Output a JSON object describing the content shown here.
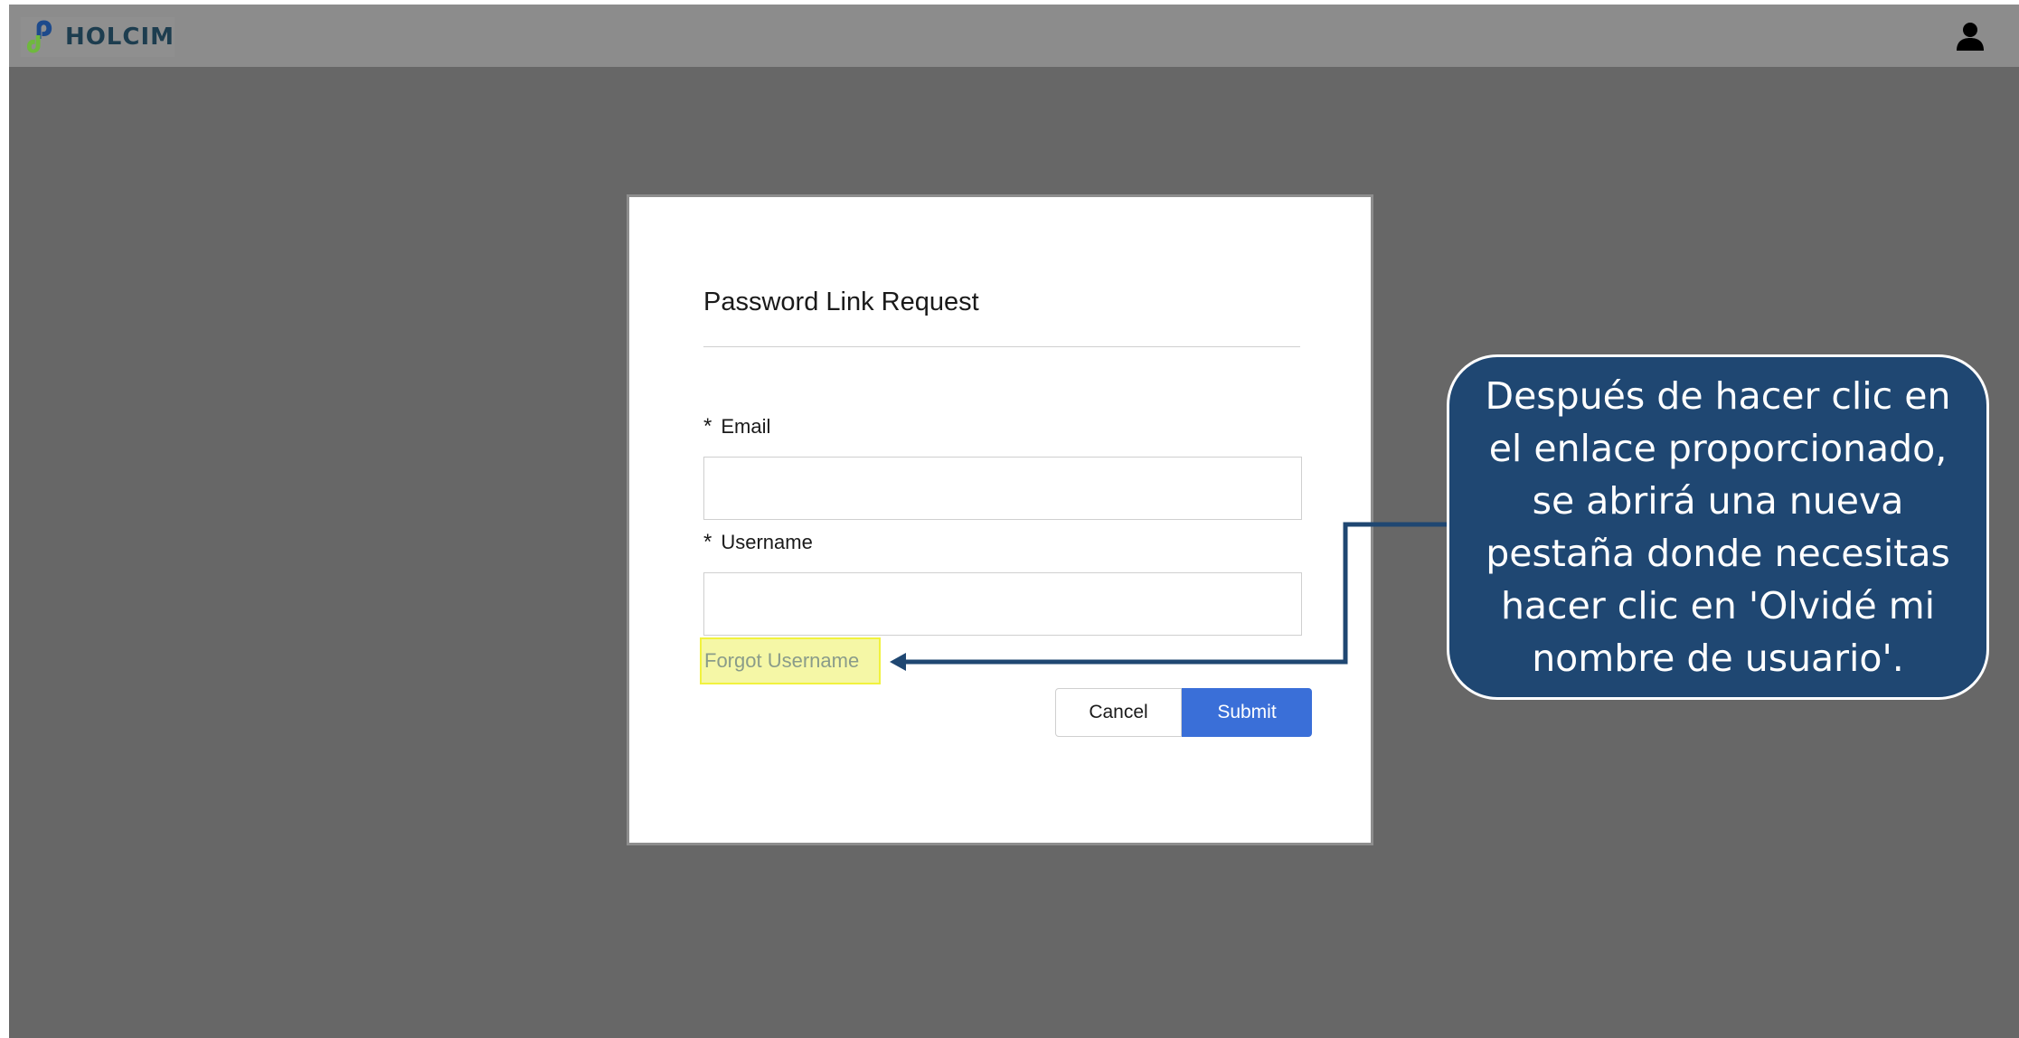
{
  "header": {
    "logo_text": "HOLCIM",
    "logo_icon": "holcim-logo-mark",
    "user_icon": "user-icon"
  },
  "modal": {
    "title": "Password Link Request",
    "email_label": "Email",
    "email_value": "",
    "username_label": "Username",
    "username_value": "",
    "required_marker": "*",
    "forgot_username": "Forgot Username",
    "cancel_label": "Cancel",
    "submit_label": "Submit"
  },
  "callout": {
    "text": "Después de hacer clic en el enlace proporcionado, se abrirá una nueva pestaña donde necesitas hacer clic en 'Olvidé mi nombre de usuario'."
  },
  "colors": {
    "topbar": "#8c8c8c",
    "backdrop": "#676767",
    "submit": "#3a6fd8",
    "callout_bg": "#1f4772",
    "highlight": "#f5f7a6",
    "highlight_border": "#f1f23e",
    "connector": "#1f4772"
  }
}
